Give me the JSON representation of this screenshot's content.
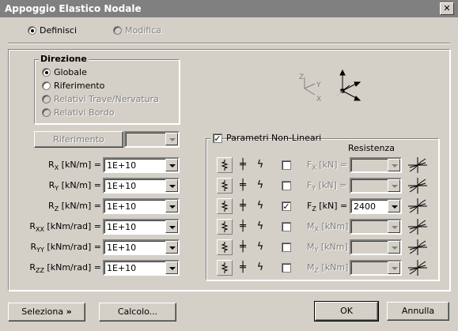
{
  "window": {
    "title": "Appoggio Elastico Nodale"
  },
  "mode": {
    "definisci": "Definisci",
    "modifica": "Modifica"
  },
  "direzione": {
    "title": "Direzione",
    "globale": "Globale",
    "riferimento": "Riferimento",
    "relativi_trave": "Relativi Trave/Nervatura",
    "relativi_bordo": "Relativi Bordo"
  },
  "riferimento_button": "Riferimento",
  "axes": {
    "z": "Z",
    "y": "Y",
    "x": "X"
  },
  "stiffness": [
    {
      "label": "R",
      "sub": "X",
      "unit": " [kN/m] =",
      "value": "1E+10"
    },
    {
      "label": "R",
      "sub": "Y",
      "unit": " [kN/m] =",
      "value": "1E+10"
    },
    {
      "label": "R",
      "sub": "Z",
      "unit": " [kN/m] =",
      "value": "1E+10"
    },
    {
      "label": "R",
      "sub": "XX",
      "unit": " [kNm/rad] =",
      "value": "1E+10"
    },
    {
      "label": "R",
      "sub": "YY",
      "unit": " [kNm/rad] =",
      "value": "1E+10"
    },
    {
      "label": "R",
      "sub": "ZZ",
      "unit": " [kNm/rad] =",
      "value": "1E+10"
    }
  ],
  "nonlinear": {
    "title": "Parametri Non-Lineari",
    "resistenza": "Resistenza",
    "rows": [
      {
        "label": "F",
        "sub": "X",
        "unit": " [kN] =",
        "value": "",
        "checked": false
      },
      {
        "label": "F",
        "sub": "Y",
        "unit": " [kN] =",
        "value": "",
        "checked": false
      },
      {
        "label": "F",
        "sub": "Z",
        "unit": " [kN] =",
        "value": "2400",
        "checked": true
      },
      {
        "label": "M",
        "sub": "X",
        "unit": " [kNm] =",
        "value": "",
        "checked": false
      },
      {
        "label": "M",
        "sub": "Y",
        "unit": " [kNm] =",
        "value": "",
        "checked": false
      },
      {
        "label": "M",
        "sub": "Z",
        "unit": " [kNm] =",
        "value": "",
        "checked": false
      }
    ]
  },
  "buttons": {
    "seleziona": "Seleziona",
    "seleziona_arrow": "»",
    "calcolo": "Calcolo...",
    "ok": "OK",
    "annulla": "Annulla"
  },
  "glyphs": {
    "equal": "╪",
    "bolt": "ϟ",
    "spring": "≷"
  }
}
